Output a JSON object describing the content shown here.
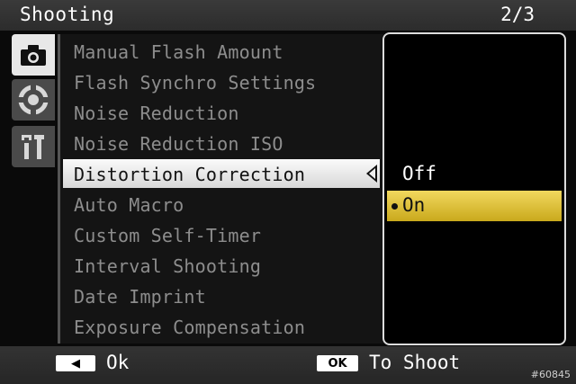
{
  "header": {
    "title": "Shooting",
    "page": "2/3"
  },
  "tabs": [
    {
      "name": "camera",
      "icon": "camera-icon",
      "active": true
    },
    {
      "name": "setup",
      "icon": "dial-icon",
      "active": false
    },
    {
      "name": "tools",
      "icon": "wrench-icon",
      "active": false
    }
  ],
  "menu": {
    "items": [
      "Manual Flash Amount",
      "Flash Synchro Settings",
      "Noise Reduction",
      "Noise Reduction ISO",
      "Distortion Correction",
      "Auto Macro",
      "Custom Self-Timer",
      "Interval Shooting",
      "Date Imprint",
      "Exposure Compensation"
    ],
    "selected": "Distortion Correction"
  },
  "options": {
    "items": [
      "Off",
      "On"
    ],
    "selected": "On"
  },
  "footer": {
    "back_key": "◀",
    "back_label": "Ok",
    "ok_key": "OK",
    "ok_label": "To Shoot"
  },
  "watermark": "#60845",
  "colors": {
    "highlight": "#e2c13a",
    "selection": "#e8e8e8"
  }
}
